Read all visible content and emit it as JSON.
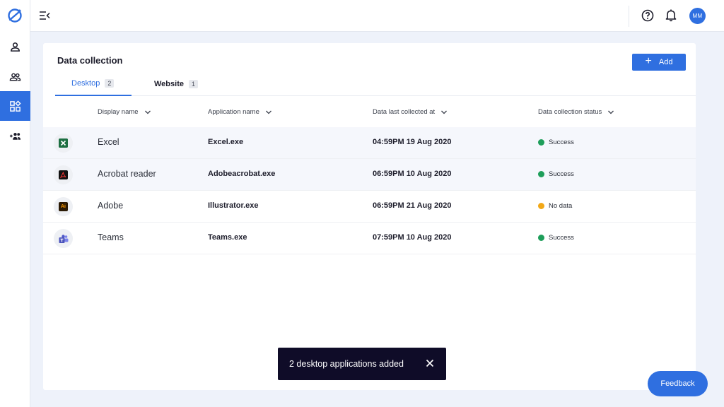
{
  "colors": {
    "accent": "#2f6fe0",
    "success": "#1e9e5a",
    "warning": "#f2a817",
    "toast_bg": "#0f0c28"
  },
  "sidebar": {
    "logo": "app-logo-icon",
    "items": [
      {
        "icon": "user-icon",
        "active": false
      },
      {
        "icon": "users-icon",
        "active": false
      },
      {
        "icon": "apps-icon",
        "active": true
      },
      {
        "icon": "add-group-icon",
        "active": false
      }
    ]
  },
  "topbar": {
    "menu_icon": "menu-collapse-icon",
    "help_icon": "help-icon",
    "bell_icon": "bell-icon",
    "avatar_initials": "MM"
  },
  "card": {
    "title": "Data collection",
    "add_label": "Add",
    "tabs": [
      {
        "label": "Desktop",
        "count": "2",
        "active": true
      },
      {
        "label": "Website",
        "count": "1",
        "active": false
      }
    ],
    "columns": [
      "Display name",
      "Application name",
      "Data last collected at",
      "Data collection status"
    ],
    "rows": [
      {
        "icon": "excel-icon",
        "display_name": "Excel",
        "app_name": "Excel.exe",
        "collected_at": "04:59PM 19 Aug 2020",
        "status": "Success",
        "status_color": "#1e9e5a"
      },
      {
        "icon": "acrobat-icon",
        "display_name": "Acrobat reader",
        "app_name": "Adobeacrobat.exe",
        "collected_at": "06:59PM 10 Aug 2020",
        "status": "Success",
        "status_color": "#1e9e5a"
      },
      {
        "icon": "illustrator-icon",
        "display_name": "Adobe",
        "app_name": "Illustrator.exe",
        "collected_at": "06:59PM 21 Aug 2020",
        "status": "No data",
        "status_color": "#f2a817"
      },
      {
        "icon": "teams-icon",
        "display_name": "Teams",
        "app_name": "Teams.exe",
        "collected_at": "07:59PM 10 Aug 2020",
        "status": "Success",
        "status_color": "#1e9e5a"
      }
    ],
    "row_icon_text": {
      "illustrator": "Ai"
    }
  },
  "toast": {
    "message": "2 desktop applications added"
  },
  "feedback_label": "Feedback"
}
